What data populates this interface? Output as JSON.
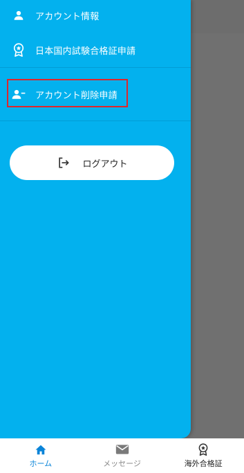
{
  "drawer": {
    "items": [
      {
        "label": "アカウント情報",
        "icon": "person-icon"
      },
      {
        "label": "日本国内試験合格証申請",
        "icon": "certificate-badge-icon"
      },
      {
        "label": "アカウント削除申請",
        "icon": "person-remove-icon"
      }
    ],
    "logout": {
      "label": "ログアウト",
      "icon": "logout-icon"
    }
  },
  "bottom_nav": {
    "items": [
      {
        "label": "ホーム",
        "icon": "home-icon",
        "active": true
      },
      {
        "label": "メッセージ",
        "icon": "mail-icon",
        "active": false
      },
      {
        "label": "海外合格証",
        "icon": "certificate-badge-icon",
        "active": false
      }
    ]
  },
  "colors": {
    "drawer_bg": "#03b1ee",
    "active_nav": "#0a84d8",
    "highlight_border": "#e0262b",
    "backdrop": "#707070"
  }
}
